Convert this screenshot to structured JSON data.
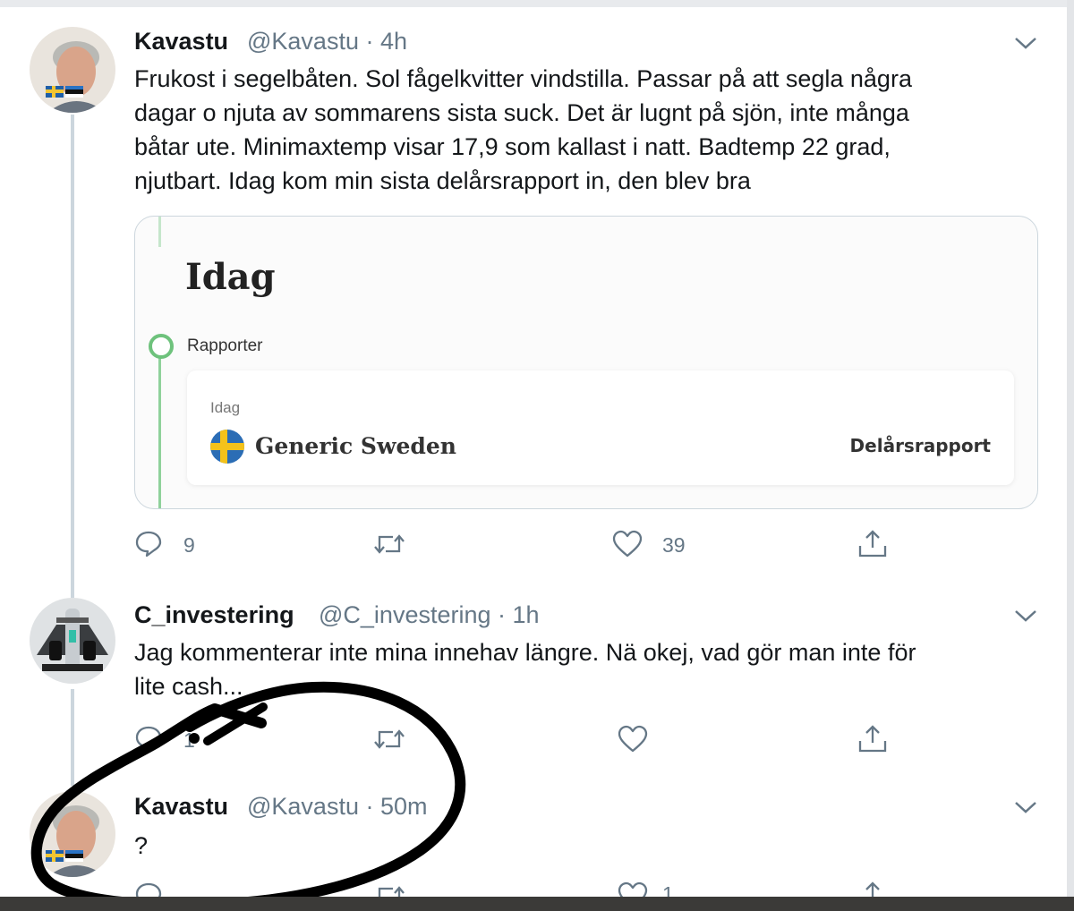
{
  "tweets": [
    {
      "name": "Kavastu",
      "handle": "@Kavastu · 4h",
      "text_lines": [
        "Frukost i segelbåten. Sol fågelkvitter vindstilla. Passar på att segla några",
        "dagar o njuta av sommarens sista suck. Det är lugnt på sjön, inte många",
        "båtar ute. Minimaxtemp visar 17,9 som kallast i natt. Badtemp 22 grad,",
        "njutbart. Idag kom min sista delårsrapport in, den blev bra"
      ],
      "card": {
        "title": "Idag",
        "section": "Rapporter",
        "item_date": "Idag",
        "company": "Generic Sweden",
        "report_type": "Delårsrapport"
      },
      "reply_count": "9",
      "retweet_count": "",
      "like_count": "39"
    },
    {
      "name": "C_investering",
      "handle": "@C_investering · 1h",
      "text_lines": [
        "Jag kommenterar inte mina innehav längre. Nä okej, vad gör man inte för",
        "lite cash..."
      ],
      "reply_count": "1",
      "retweet_count": "",
      "like_count": ""
    },
    {
      "name": "Kavastu",
      "handle": "@Kavastu · 50m",
      "text_lines": [
        "?"
      ],
      "reply_count": "",
      "retweet_count": "",
      "like_count": "1"
    }
  ],
  "icons": {
    "reply": "reply-icon",
    "retweet": "retweet-icon",
    "like": "like-icon",
    "share": "share-icon",
    "menu": "chevron-down-icon"
  },
  "colors": {
    "text": "#14171a",
    "secondary": "#657786",
    "border": "#ccd6dd",
    "timeline_green": "#6ec27c"
  }
}
